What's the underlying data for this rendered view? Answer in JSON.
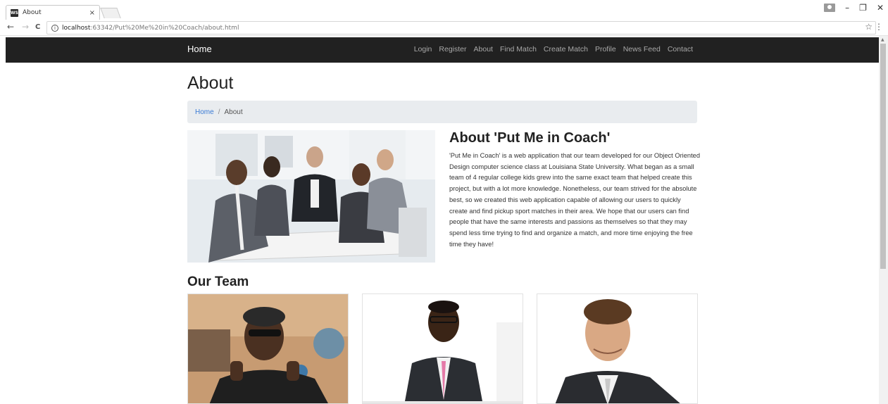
{
  "browser": {
    "tab_title": "About",
    "tab_close": "×",
    "favicon_text": "WS",
    "url_host": "localhost",
    "url_path": ":63342/Put%20Me%20in%20Coach/about.html",
    "back": "←",
    "forward": "→",
    "reload": "C",
    "star": "☆",
    "menu": "⋮",
    "minimize": "–",
    "restore": "❐",
    "close": "✕"
  },
  "navbar": {
    "brand": "Home",
    "links": [
      "Login",
      "Register",
      "About",
      "Find Match",
      "Create Match",
      "Profile",
      "News Feed",
      "Contact"
    ]
  },
  "page": {
    "title": "About",
    "breadcrumb": {
      "home": "Home",
      "separator": "/",
      "current": "About"
    },
    "about_heading": "About 'Put Me in Coach'",
    "about_text": "'Put Me in Coach' is a web application that our team developed for our Object Oriented Design computer science class at Louisiana State University. What began as a small team of 4 regular college kids grew into the same exact team that helped create this project, but with a lot more knowledge. Nonetheless, our team strived for the absolute best, so we created this web application capable of allowing our users to quickly create and find pickup sport matches in their area. We hope that our users can find people that have the same interests and passions as themselves so that they may spend less time trying to find and organize a match, and more time enjoying the free time they have!",
    "team_heading": "Our Team"
  },
  "colors": {
    "navbar_bg": "#212121",
    "nav_link": "#a8a8a8",
    "breadcrumb_bg": "#e9ecef",
    "link_blue": "#3a7bd5"
  }
}
